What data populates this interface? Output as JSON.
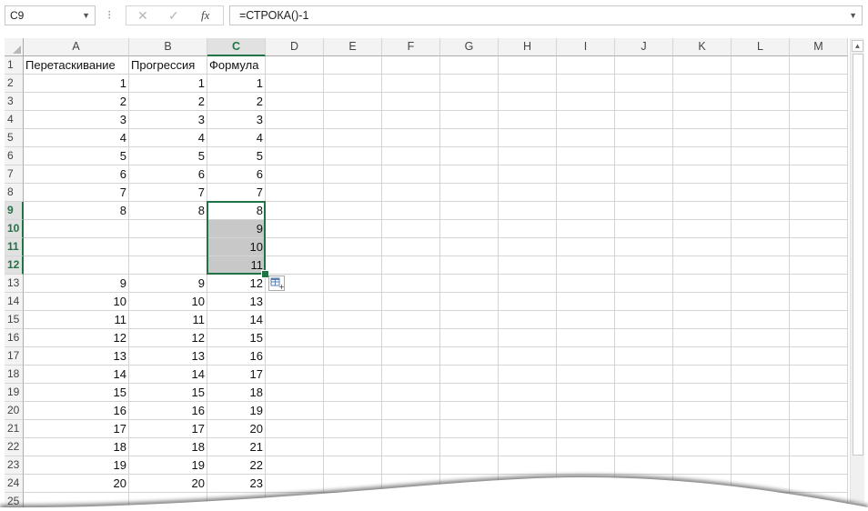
{
  "formula_bar": {
    "name_box": "C9",
    "dots": "⁝",
    "cancel_icon": "✕",
    "enter_icon": "✓",
    "fx_label": "fx",
    "formula": "=СТРОКА()-1"
  },
  "columns": [
    "A",
    "B",
    "C",
    "D",
    "E",
    "F",
    "G",
    "H",
    "I",
    "J",
    "K",
    "L",
    "M"
  ],
  "selected_column": "C",
  "selected_rows": [
    9,
    10,
    11,
    12
  ],
  "rows": [
    {
      "n": "1",
      "a": "Перетаскивание",
      "b": "Прогрессия",
      "c": "Формула"
    },
    {
      "n": "2",
      "a": "1",
      "b": "1",
      "c": "1"
    },
    {
      "n": "3",
      "a": "2",
      "b": "2",
      "c": "2"
    },
    {
      "n": "4",
      "a": "3",
      "b": "3",
      "c": "3"
    },
    {
      "n": "5",
      "a": "4",
      "b": "4",
      "c": "4"
    },
    {
      "n": "6",
      "a": "5",
      "b": "5",
      "c": "5"
    },
    {
      "n": "7",
      "a": "6",
      "b": "6",
      "c": "6"
    },
    {
      "n": "8",
      "a": "7",
      "b": "7",
      "c": "7"
    },
    {
      "n": "9",
      "a": "8",
      "b": "8",
      "c": "8"
    },
    {
      "n": "10",
      "a": "",
      "b": "",
      "c": "9"
    },
    {
      "n": "11",
      "a": "",
      "b": "",
      "c": "10"
    },
    {
      "n": "12",
      "a": "",
      "b": "",
      "c": "11"
    },
    {
      "n": "13",
      "a": "9",
      "b": "9",
      "c": "12"
    },
    {
      "n": "14",
      "a": "10",
      "b": "10",
      "c": "13"
    },
    {
      "n": "15",
      "a": "11",
      "b": "11",
      "c": "14"
    },
    {
      "n": "16",
      "a": "12",
      "b": "12",
      "c": "15"
    },
    {
      "n": "17",
      "a": "13",
      "b": "13",
      "c": "16"
    },
    {
      "n": "18",
      "a": "14",
      "b": "14",
      "c": "17"
    },
    {
      "n": "19",
      "a": "15",
      "b": "15",
      "c": "18"
    },
    {
      "n": "20",
      "a": "16",
      "b": "16",
      "c": "19"
    },
    {
      "n": "21",
      "a": "17",
      "b": "17",
      "c": "20"
    },
    {
      "n": "22",
      "a": "18",
      "b": "18",
      "c": "21"
    },
    {
      "n": "23",
      "a": "19",
      "b": "19",
      "c": "22"
    },
    {
      "n": "24",
      "a": "20",
      "b": "20",
      "c": "23"
    },
    {
      "n": "25",
      "a": "",
      "b": "",
      "c": ""
    }
  ],
  "colors": {
    "accent": "#217346",
    "highlight": "#c8c8c8"
  }
}
